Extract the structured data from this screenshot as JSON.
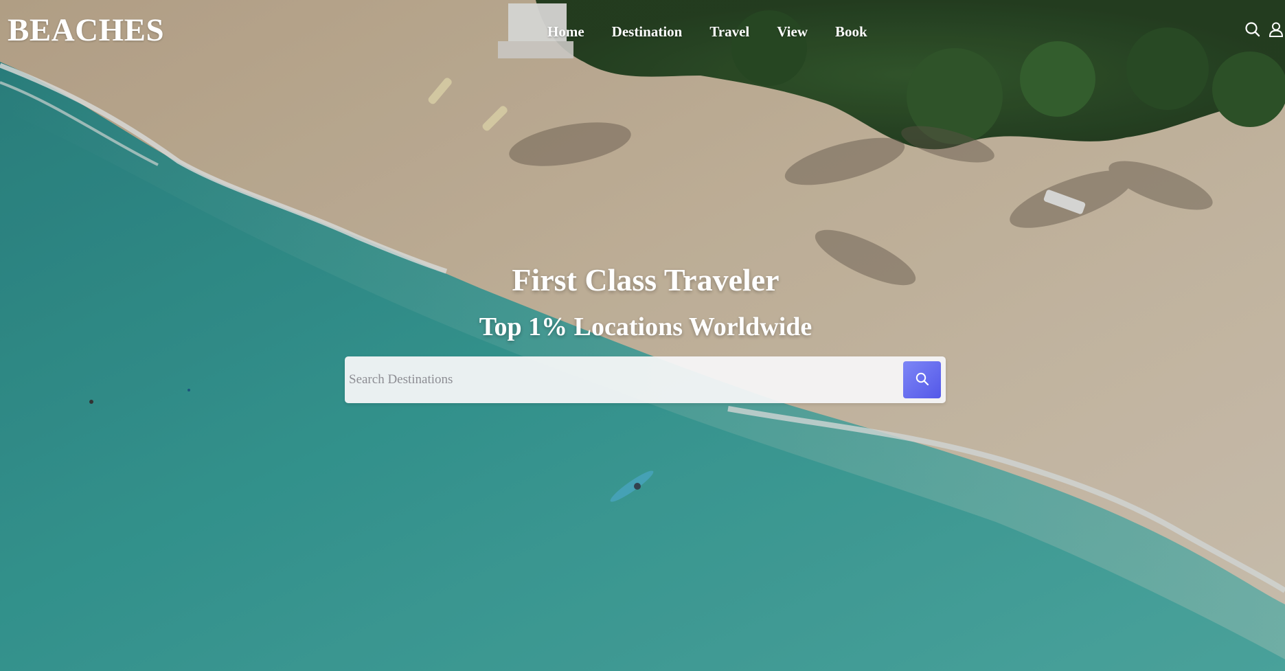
{
  "brand": {
    "logo_text": "BEACHES"
  },
  "nav": {
    "links": [
      {
        "label": "Home"
      },
      {
        "label": "Destination"
      },
      {
        "label": "Travel"
      },
      {
        "label": "View"
      },
      {
        "label": "Book"
      }
    ],
    "icons": [
      "search-icon",
      "user-icon"
    ]
  },
  "hero": {
    "title": "First Class Traveler",
    "subtitle": "Top 1% Locations Worldwide"
  },
  "search": {
    "placeholder": "Search Destinations",
    "value": "",
    "button_icon": "search-icon"
  },
  "colors": {
    "sea": "#3fa9a1",
    "sand": "#d9c7ab",
    "search_button": "#5e63ee",
    "text": "#ffffff"
  }
}
